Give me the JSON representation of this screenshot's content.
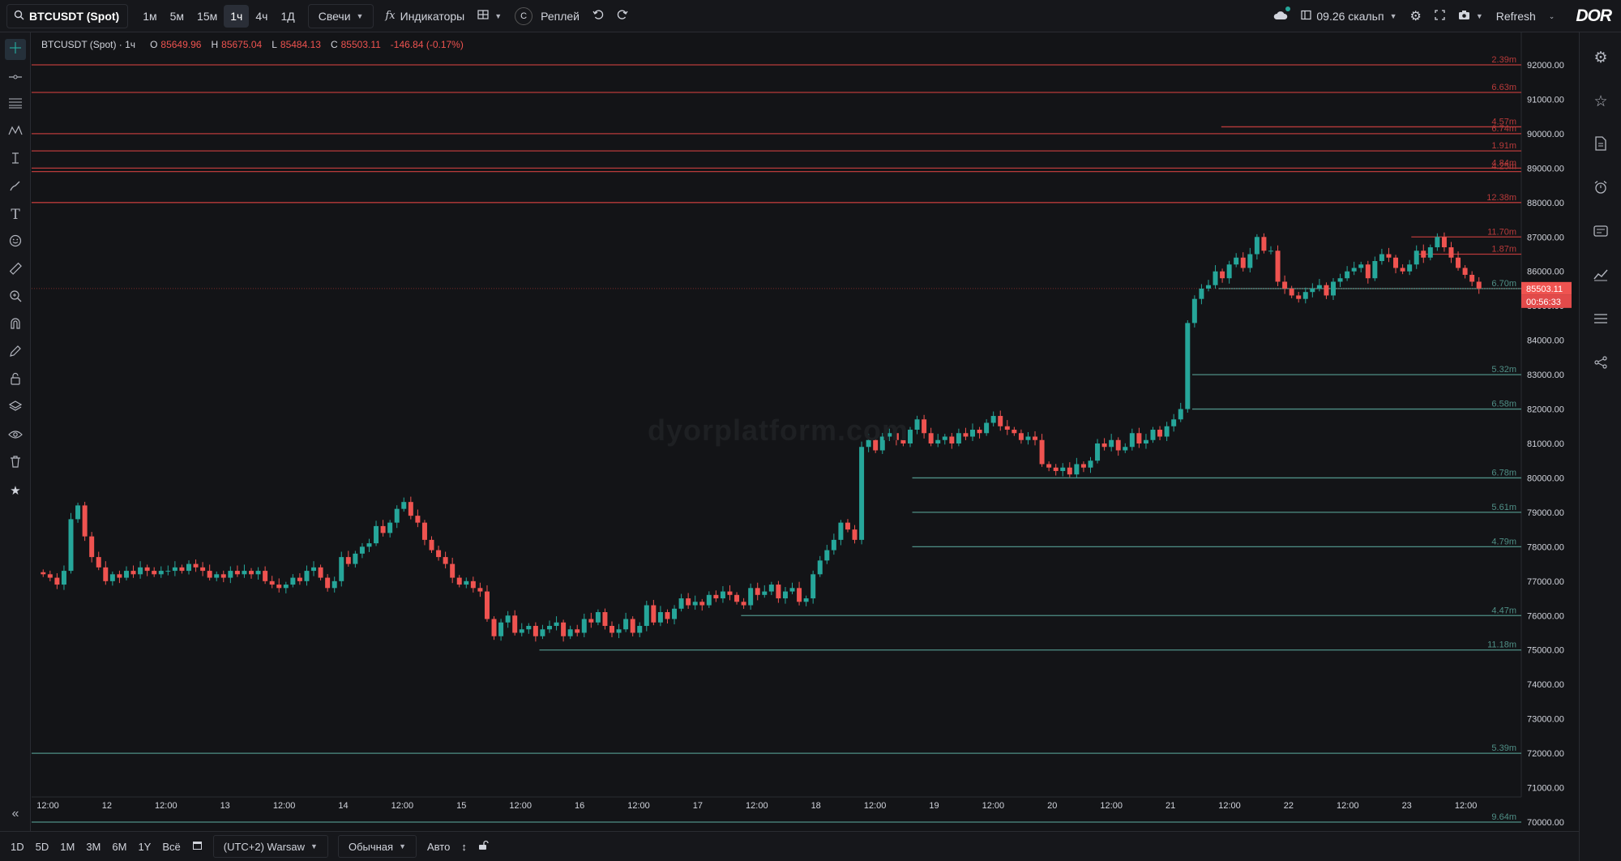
{
  "topbar": {
    "symbol": "BTCUSDT (Spot)",
    "timeframes": [
      "1м",
      "5м",
      "15м",
      "1ч",
      "4ч",
      "1Д"
    ],
    "active_timeframe": "1ч",
    "chart_type": "Свечи",
    "indicators_label": "Индикаторы",
    "replay_c": "C",
    "replay_label": "Реплей",
    "layout_name": "09.26 скальп",
    "refresh_label": "Refresh",
    "logo": "DOR"
  },
  "legend": {
    "symbol": "BTCUSDT (Spot) · 1ч",
    "o_label": "O",
    "o_value": "85649.96",
    "h_label": "H",
    "h_value": "85675.04",
    "l_label": "L",
    "l_value": "85484.13",
    "c_label": "C",
    "c_value": "85503.11",
    "change": "-146.84 (-0.17%)"
  },
  "watermark": "dyorplatform.com",
  "price_axis": [
    "92000.00",
    "91000.00",
    "90000.00",
    "89000.00",
    "88000.00",
    "87000.00",
    "86000.00",
    "85000.00",
    "84000.00",
    "83000.00",
    "82000.00",
    "81000.00",
    "80000.00",
    "79000.00",
    "78000.00",
    "77000.00",
    "76000.00",
    "75000.00",
    "74000.00",
    "73000.00",
    "72000.00",
    "71000.00",
    "70000.00"
  ],
  "current_price": {
    "value": "85503.11",
    "countdown": "00:56:33"
  },
  "time_axis": [
    "12:00",
    "12",
    "12:00",
    "13",
    "12:00",
    "14",
    "12:00",
    "15",
    "12:00",
    "16",
    "12:00",
    "17",
    "12:00",
    "18",
    "12:00",
    "19",
    "12:00",
    "20",
    "12:00",
    "21",
    "12:00",
    "22",
    "12:00",
    "23",
    "12:00"
  ],
  "levels": [
    {
      "price": 92000,
      "label": "2.39m",
      "side": "resistance",
      "start": 0
    },
    {
      "price": 91200,
      "label": "6.63m",
      "side": "resistance",
      "start": 0
    },
    {
      "price": 90200,
      "label": "4.57m",
      "side": "resistance",
      "start": 0.82
    },
    {
      "price": 90000,
      "label": "6.74m",
      "side": "resistance",
      "start": 0
    },
    {
      "price": 89500,
      "label": "1.91m",
      "side": "resistance",
      "start": 0
    },
    {
      "price": 89000,
      "label": "4.84m",
      "side": "resistance",
      "start": 0
    },
    {
      "price": 88900,
      "label": "4.25m",
      "side": "resistance",
      "start": 0
    },
    {
      "price": 88000,
      "label": "12.38m",
      "side": "resistance",
      "start": 0
    },
    {
      "price": 87000,
      "label": "11.70m",
      "side": "resistance",
      "start": 0.951
    },
    {
      "price": 86500,
      "label": "1.87m",
      "side": "resistance",
      "start": 0.953
    },
    {
      "price": 85500,
      "label": "6.70m",
      "side": "support",
      "start": 0.818
    },
    {
      "price": 83000,
      "label": "5.32m",
      "side": "support",
      "start": 0.8
    },
    {
      "price": 82000,
      "label": "6.58m",
      "side": "support",
      "start": 0.8
    },
    {
      "price": 80000,
      "label": "6.78m",
      "side": "support",
      "start": 0.607
    },
    {
      "price": 79000,
      "label": "5.61m",
      "side": "support",
      "start": 0.607
    },
    {
      "price": 78000,
      "label": "4.79m",
      "side": "support",
      "start": 0.607
    },
    {
      "price": 76000,
      "label": "4.47m",
      "side": "support",
      "start": 0.489
    },
    {
      "price": 75000,
      "label": "11.18m",
      "side": "support",
      "start": 0.35
    },
    {
      "price": 72000,
      "label": "5.39m",
      "side": "support",
      "start": 0
    },
    {
      "price": 70000,
      "label": "9.64m",
      "side": "support",
      "start": 0
    }
  ],
  "chart_data": {
    "type": "candlestick",
    "x_start": "11 12:00",
    "interval": "1h",
    "ylim": [
      69700,
      92300
    ],
    "close_series": [
      77200,
      77100,
      76900,
      77300,
      78800,
      79200,
      78300,
      77700,
      77400,
      77000,
      77200,
      77100,
      77300,
      77200,
      77400,
      77300,
      77200,
      77300,
      77300,
      77400,
      77300,
      77500,
      77400,
      77300,
      77100,
      77200,
      77100,
      77300,
      77200,
      77300,
      77200,
      77300,
      77000,
      76900,
      76800,
      76900,
      77100,
      77000,
      77300,
      77400,
      77100,
      76800,
      77000,
      77700,
      77500,
      77800,
      78000,
      78100,
      78600,
      78400,
      78700,
      79100,
      79300,
      78900,
      78700,
      78200,
      77900,
      77700,
      77500,
      77100,
      76900,
      77000,
      76800,
      76700,
      75900,
      75400,
      75800,
      76000,
      75500,
      75600,
      75700,
      75400,
      75600,
      75700,
      75800,
      75400,
      75600,
      75500,
      75900,
      75800,
      76100,
      75700,
      75500,
      75600,
      75900,
      75500,
      75700,
      76300,
      75800,
      76100,
      75900,
      76200,
      76500,
      76300,
      76400,
      76300,
      76600,
      76500,
      76700,
      76600,
      76400,
      76300,
      76800,
      76600,
      76700,
      76900,
      76500,
      76700,
      76800,
      76400,
      76500,
      77200,
      77600,
      77900,
      78200,
      78700,
      78500,
      78200,
      80900,
      81100,
      80800,
      81200,
      81300,
      81100,
      81000,
      81400,
      81700,
      81300,
      81000,
      81100,
      81200,
      81000,
      81300,
      81200,
      81400,
      81300,
      81600,
      81800,
      81500,
      81400,
      81300,
      81100,
      81200,
      81100,
      80400,
      80300,
      80200,
      80300,
      80100,
      80400,
      80300,
      80500,
      81000,
      80900,
      81100,
      80800,
      80900,
      81300,
      81000,
      81100,
      81400,
      81200,
      81500,
      81700,
      82000,
      84500,
      85200,
      85500,
      85600,
      86000,
      85800,
      86200,
      86400,
      86100,
      86500,
      87000,
      86600,
      86600,
      85700,
      85500,
      85300,
      85200,
      85400,
      85500,
      85600,
      85300,
      85700,
      85800,
      86000,
      86100,
      86200,
      85800,
      86300,
      86500,
      86400,
      86100,
      86000,
      86200,
      86600,
      86400,
      86700,
      87000,
      86700,
      86400,
      86100,
      85900,
      85700,
      85503
    ]
  },
  "bottombar": {
    "ranges": [
      "1D",
      "5D",
      "1M",
      "3M",
      "6M",
      "1Y",
      "Всё"
    ],
    "timezone": "(UTC+2) Warsaw",
    "scale_mode": "Обычная",
    "auto_label": "Авто"
  },
  "colors": {
    "up": "#26a69a",
    "down": "#ef5350",
    "resistance": "#b83a3a",
    "support": "#4f8f86",
    "bg": "#131417"
  }
}
